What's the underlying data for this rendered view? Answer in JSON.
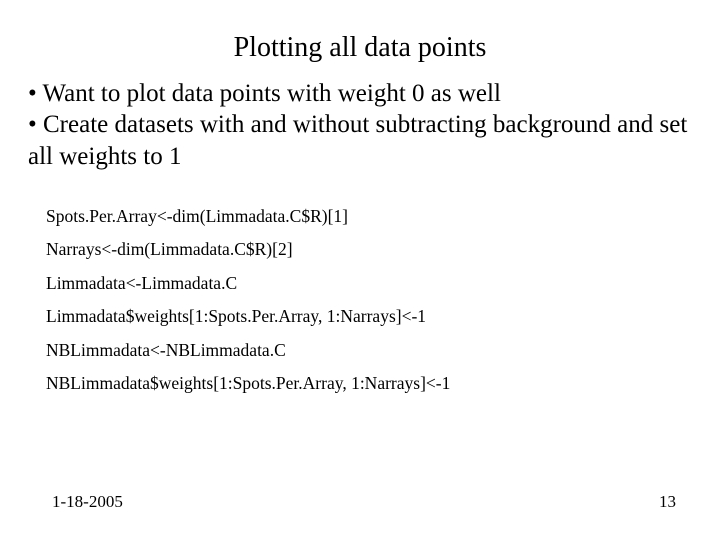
{
  "title": "Plotting all data points",
  "bullets": [
    "• Want to plot data points with weight 0 as well",
    "• Create datasets with and without subtracting background and set all weights to 1"
  ],
  "code": [
    "Spots.Per.Array<-dim(Limmadata.C$R)[1]",
    "Narrays<-dim(Limmadata.C$R)[2]",
    "Limmadata<-Limmadata.C",
    "Limmadata$weights[1:Spots.Per.Array, 1:Narrays]<-1",
    "NBLimmadata<-NBLimmadata.C",
    "NBLimmadata$weights[1:Spots.Per.Array, 1:Narrays]<-1"
  ],
  "footer": {
    "date": "1-18-2005",
    "page": "13"
  }
}
